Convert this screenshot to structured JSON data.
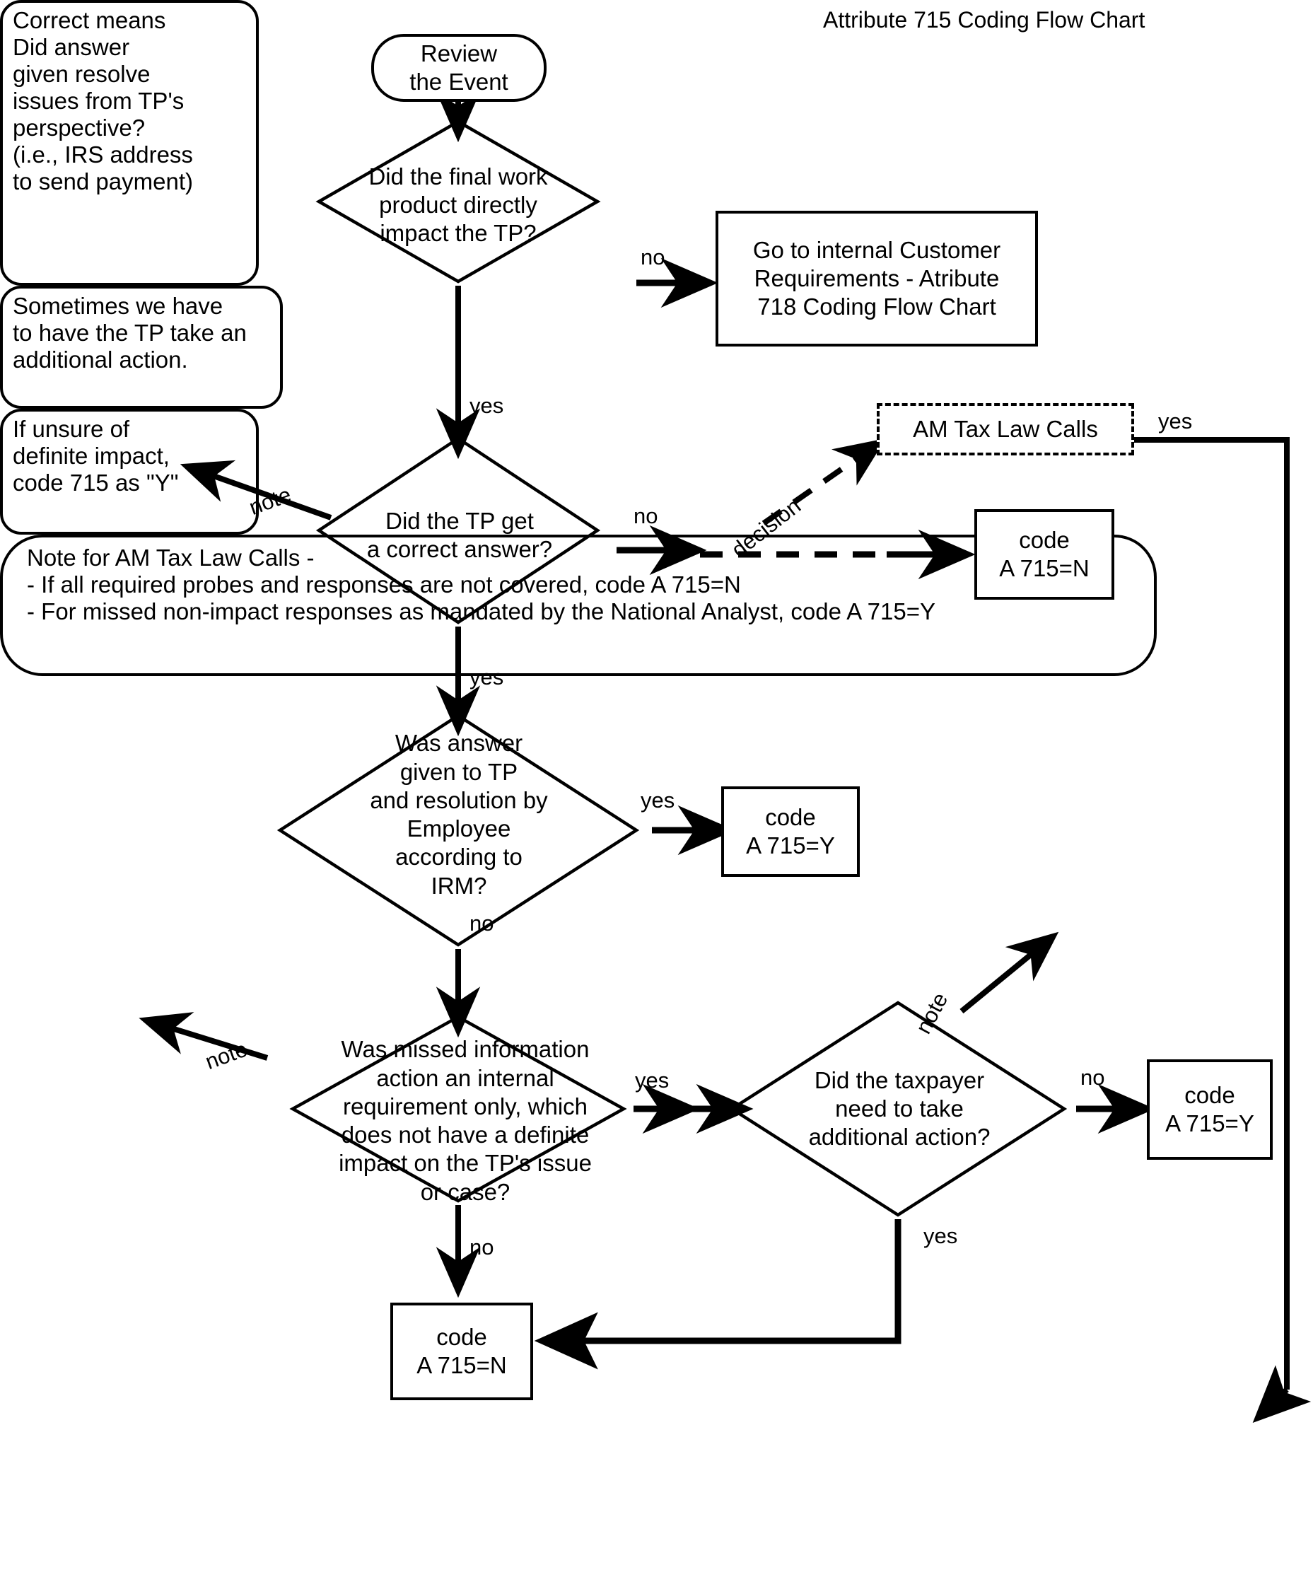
{
  "title": "Attribute 715 Coding Flow Chart",
  "nodes": {
    "start": {
      "label": "Review\nthe Event"
    },
    "note_correct_means": {
      "label": "Correct means\nDid answer\ngiven resolve\nissues from TP's\nperspective?\n(i.e., IRS address\nto send payment)"
    },
    "decision_impact": {
      "label": "Did the final work\nproduct directly\nimpact the TP?"
    },
    "goto_718": {
      "label": "Go to internal Customer\nRequirements - Atribute\n718 Coding Flow Chart"
    },
    "decision_correct_answer": {
      "label": "Did the TP get\na correct answer?"
    },
    "am_tax_law_calls": {
      "label": "AM Tax Law Calls"
    },
    "code_n_right": {
      "label": "code\nA 715=N"
    },
    "decision_irm": {
      "label": "Was answer\ngiven to TP\nand resolution by\nEmployee\naccording to\nIRM?"
    },
    "code_y_mid": {
      "label": "code\nA 715=Y"
    },
    "note_sometimes": {
      "label": "Sometimes we have\nto have the TP take an\nadditional action."
    },
    "note_if_unsure": {
      "label": "If unsure of\ndefinite impact,\ncode 715 as \"Y\""
    },
    "decision_missed_info": {
      "label": "Was missed information\naction an internal\nrequirement only, which\ndoes not have a definite\nimpact on the TP's issue\nor case?"
    },
    "decision_taxpayer_action": {
      "label": "Did the taxpayer\nneed to take\nadditional action?"
    },
    "code_y_right": {
      "label": "code\nA 715=Y"
    },
    "code_n_bottom": {
      "label": "code\nA 715=N"
    },
    "note_am_tax": {
      "label": "Note for AM Tax Law Calls -\n- If all required probes and responses are not covered, code A 715=N\n- For missed non-impact responses as mandated by the National Analyst, code A 715=Y"
    }
  },
  "edge_labels": {
    "impact_no": "no",
    "impact_yes": "yes",
    "correct_note": "note",
    "correct_no": "no",
    "correct_yes": "yes",
    "decision_branch": "decision",
    "am_yes": "yes",
    "irm_yes": "yes",
    "irm_no": "no",
    "missed_note": "note",
    "missed_yes": "yes",
    "missed_no": "no",
    "taxpayer_note": "note",
    "taxpayer_no": "no",
    "taxpayer_yes": "yes"
  },
  "colors": {
    "stroke": "#000000",
    "background": "#ffffff"
  }
}
